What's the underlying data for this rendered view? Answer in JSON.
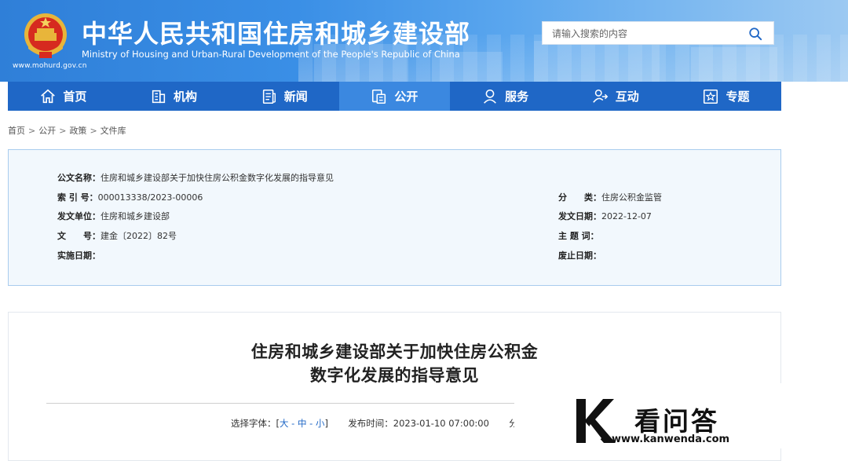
{
  "header": {
    "title_cn": "中华人民共和国住房和城乡建设部",
    "title_en": "Ministry of Housing and Urban-Rural Development of the People's Republic of China",
    "site_url": "www.mohurd.gov.cn",
    "search_placeholder": "请输入搜索的内容"
  },
  "nav": [
    {
      "label": "首页",
      "icon": "home-icon"
    },
    {
      "label": "机构",
      "icon": "building-icon"
    },
    {
      "label": "新闻",
      "icon": "news-icon"
    },
    {
      "label": "公开",
      "icon": "disclosure-icon",
      "active": true
    },
    {
      "label": "服务",
      "icon": "service-icon"
    },
    {
      "label": "互动",
      "icon": "interaction-icon"
    },
    {
      "label": "专题",
      "icon": "topic-icon"
    }
  ],
  "breadcrumb": [
    "首页",
    "公开",
    "政策",
    "文件库"
  ],
  "info": {
    "doc_name_label": "公文名称：",
    "doc_name": "住房和城乡建设部关于加快住房公积金数字化发展的指导意见",
    "index_label": "索 引 号：",
    "index": "000013338/2023-00006",
    "category_label": "分　　类：",
    "category": "住房公积金监管",
    "issuer_label": "发文单位：",
    "issuer": "住房和城乡建设部",
    "issue_date_label": "发文日期：",
    "issue_date": "2022-12-07",
    "doc_no_label": "文　　号：",
    "doc_no": "建金〔2022〕82号",
    "keywords_label": "主 题 词：",
    "keywords": "",
    "effective_label": "实施日期：",
    "effective": "",
    "expiry_label": "废止日期：",
    "expiry": ""
  },
  "article": {
    "title_line1": "住房和城乡建设部关于加快住房公积金",
    "title_line2": "数字化发展的指导意见",
    "font_select_label": "选择字体：[",
    "font_large": "大",
    "font_medium": "中",
    "font_small": "小",
    "font_close": "]",
    "publish_label": "发布时间：",
    "publish_time": "2023-01-10 07:00:00",
    "share_partial": "分享"
  },
  "watermark": {
    "text": "看问答",
    "url": "www.kanwenda.com"
  },
  "colors": {
    "nav_bg": "#1f67c6",
    "nav_active": "#3b88e0",
    "info_bg": "#f2f8fd",
    "info_border": "#a9ccee"
  }
}
